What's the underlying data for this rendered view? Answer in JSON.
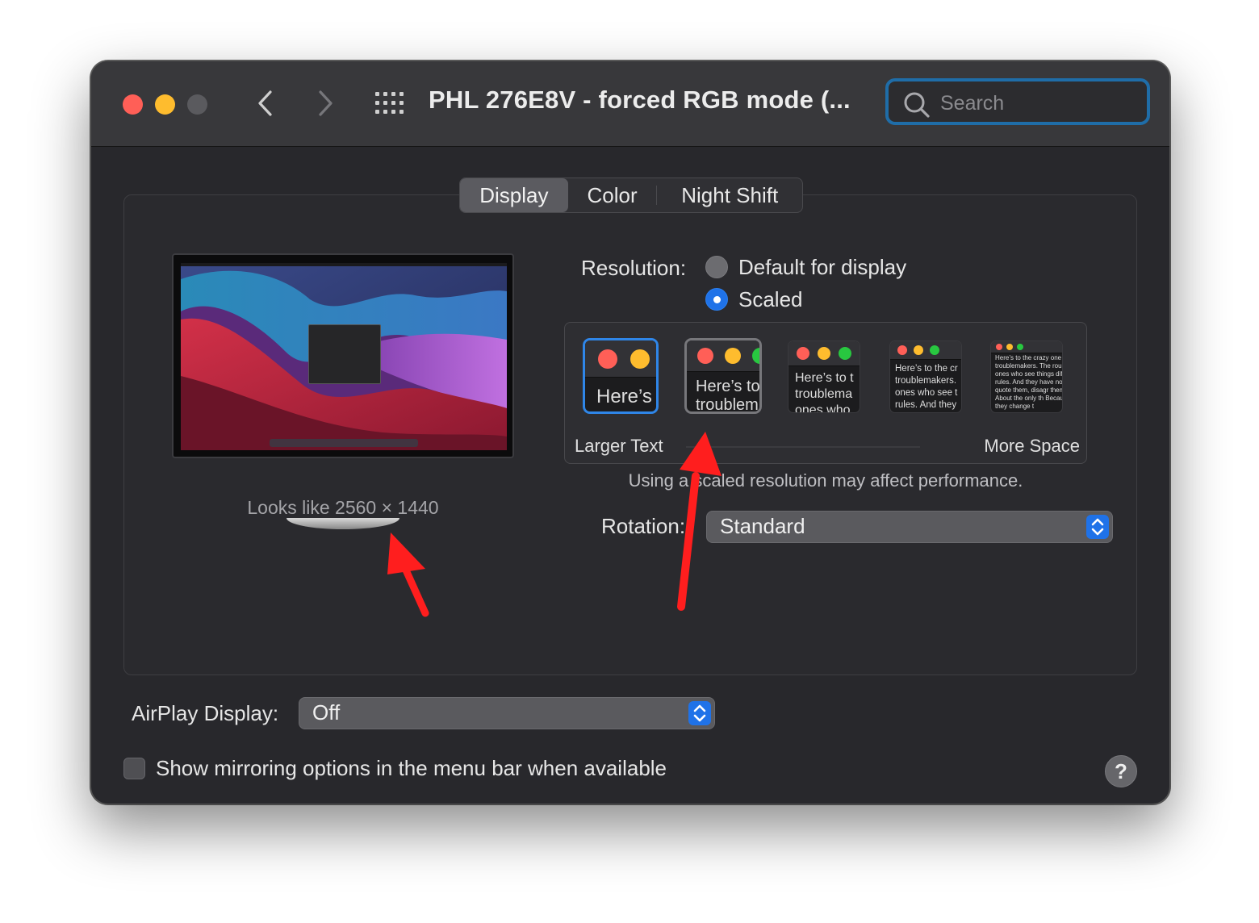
{
  "window": {
    "title": "PHL 276E8V - forced RGB mode (...",
    "search_placeholder": "Search"
  },
  "toolbar": {
    "icons": [
      "chevron-left-icon",
      "chevron-right-icon",
      "grid-icon",
      "search-icon"
    ]
  },
  "tabs": [
    {
      "label": "Display",
      "active": true
    },
    {
      "label": "Color",
      "active": false
    },
    {
      "label": "Night Shift",
      "active": false
    }
  ],
  "display": {
    "looks_like": "Looks like 2560 × 1440",
    "resolution_label": "Resolution:",
    "resolution_options": [
      {
        "label": "Default for display",
        "selected": false
      },
      {
        "label": "Scaled",
        "selected": true
      }
    ],
    "scale_options": [
      {
        "preview_text": "Here’s",
        "selected": true
      },
      {
        "preview_text": "Here’s to troublem",
        "selected": false
      },
      {
        "preview_text": "Here’s to t troublema ones who",
        "selected": false
      },
      {
        "preview_text": "Here’s to the cr troublemakers. ones who see t rules. And they",
        "selected": false
      },
      {
        "preview_text": "Here’s to the crazy one troublemakers. The rou ones who see things dif rules. And they have no can quote them, disagr them. About the only th Because they change t",
        "selected": false
      }
    ],
    "larger_text": "Larger Text",
    "more_space": "More Space",
    "performance_note": "Using a scaled resolution may affect performance.",
    "rotation_label": "Rotation:",
    "rotation_value": "Standard"
  },
  "airplay": {
    "label": "AirPlay Display:",
    "value": "Off"
  },
  "mirroring": {
    "label": "Show mirroring options in the menu bar when available",
    "checked": false
  },
  "help": {
    "label": "?"
  },
  "colors": {
    "accent": "#1f72e8",
    "focus_ring": "#1f6da8",
    "annotation_arrow": "#ff1e1e",
    "close": "#ff5f57",
    "minimize": "#febc2e",
    "zoom_disabled": "#5a5a5e"
  }
}
